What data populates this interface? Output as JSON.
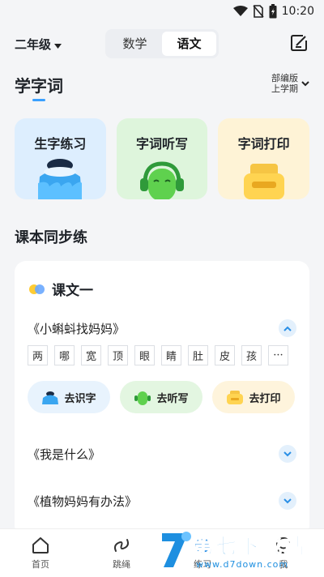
{
  "status_bar": {
    "time": "10:20",
    "icons": [
      "wifi-icon",
      "no-sim-icon",
      "battery-icon"
    ]
  },
  "header": {
    "grade": "二年级",
    "subject_tabs": [
      {
        "label": "数学",
        "active": false
      },
      {
        "label": "语文",
        "active": true
      }
    ],
    "edit_icon": "edit-icon"
  },
  "section": {
    "title": "学字词",
    "edition_line1": "部编版",
    "edition_line2": "上学期"
  },
  "feature_cards": [
    {
      "label": "生字练习",
      "icon": "inkwell-icon",
      "color": "#ddeefe"
    },
    {
      "label": "字词听写",
      "icon": "headphones-robot-icon",
      "color": "#def5dc"
    },
    {
      "label": "字词打印",
      "icon": "printer-icon",
      "color": "#fef3d6"
    }
  ],
  "sync_title": "课本同步练",
  "lesson": {
    "title": "课文一",
    "texts": [
      {
        "name": "《小蝌蚪找妈妈》",
        "expanded": true
      },
      {
        "name": "《我是什么》",
        "expanded": false
      },
      {
        "name": "《植物妈妈有办法》",
        "expanded": false
      }
    ],
    "chars": [
      "两",
      "哪",
      "宽",
      "顶",
      "眼",
      "睛",
      "肚",
      "皮",
      "孩",
      "···"
    ],
    "actions": [
      "去识字",
      "去听写",
      "去打印"
    ]
  },
  "tabbar": [
    "首页",
    "跳绳",
    "练习",
    "我"
  ],
  "watermark": {
    "text": "第七下载站",
    "url": "www.d7down.com"
  }
}
